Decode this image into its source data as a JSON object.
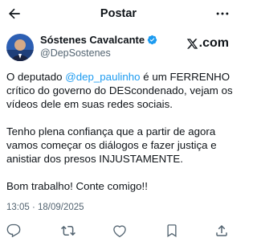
{
  "header": {
    "title": "Postar",
    "back_icon": "arrow-left-icon",
    "more_icon": "more-dots-icon"
  },
  "author": {
    "name": "Sóstenes Cavalcante",
    "handle": "@DepSostenes",
    "verified_color": "#1d9bf0"
  },
  "brand": {
    "label": ".com"
  },
  "post": {
    "line1_prefix": "O deputado ",
    "mention": "@dep_paulinho",
    "line1_suffix": " é um FERRENHO crítico do governo do DEScondenado, vejam os vídeos dele em suas redes sociais.",
    "para2": "Tenho plena confiança que a partir de agora vamos começar os diálogos e fazer justiça e anistiar dos presos INJUSTAMENTE.",
    "para3": "Bom trabalho! Conte comigo!!"
  },
  "meta": {
    "timestamp": "13:05 · 18/09/2025"
  },
  "actions": {
    "reply_icon": "reply-icon",
    "repost_icon": "repost-icon",
    "like_icon": "heart-icon",
    "bookmark_icon": "bookmark-icon",
    "share_icon": "share-icon"
  },
  "colors": {
    "accent": "#1d9bf0",
    "muted": "#536471",
    "text": "#0f1419"
  }
}
